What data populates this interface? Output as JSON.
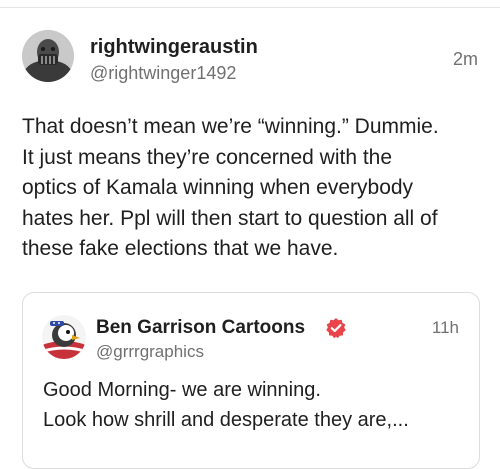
{
  "post": {
    "author": {
      "display_name": "rightwingeraustin",
      "handle": "@rightwinger1492",
      "avatar_icon": "masked-figure-avatar"
    },
    "timestamp": "2m",
    "body_lines": [
      "That doesn’t mean we’re “winning.” Dummie.",
      "It just means they’re concerned with the",
      "optics of Kamala winning when everybody",
      "hates her. Ppl will then start to question all of",
      "these fake elections that we have."
    ]
  },
  "quoted_post": {
    "author": {
      "display_name": "Ben Garrison Cartoons",
      "handle": "@grrrgraphics",
      "verified": true,
      "avatar_icon": "cartoon-eagle-avatar"
    },
    "timestamp": "11h",
    "body_lines": [
      "Good Morning- we are winning.",
      "Look how shrill and desperate they are,..."
    ]
  },
  "colors": {
    "text": "#1f1f1f",
    "secondary_text": "#707070",
    "verified_badge": "#e8444a",
    "border": "#dcdcdc"
  }
}
